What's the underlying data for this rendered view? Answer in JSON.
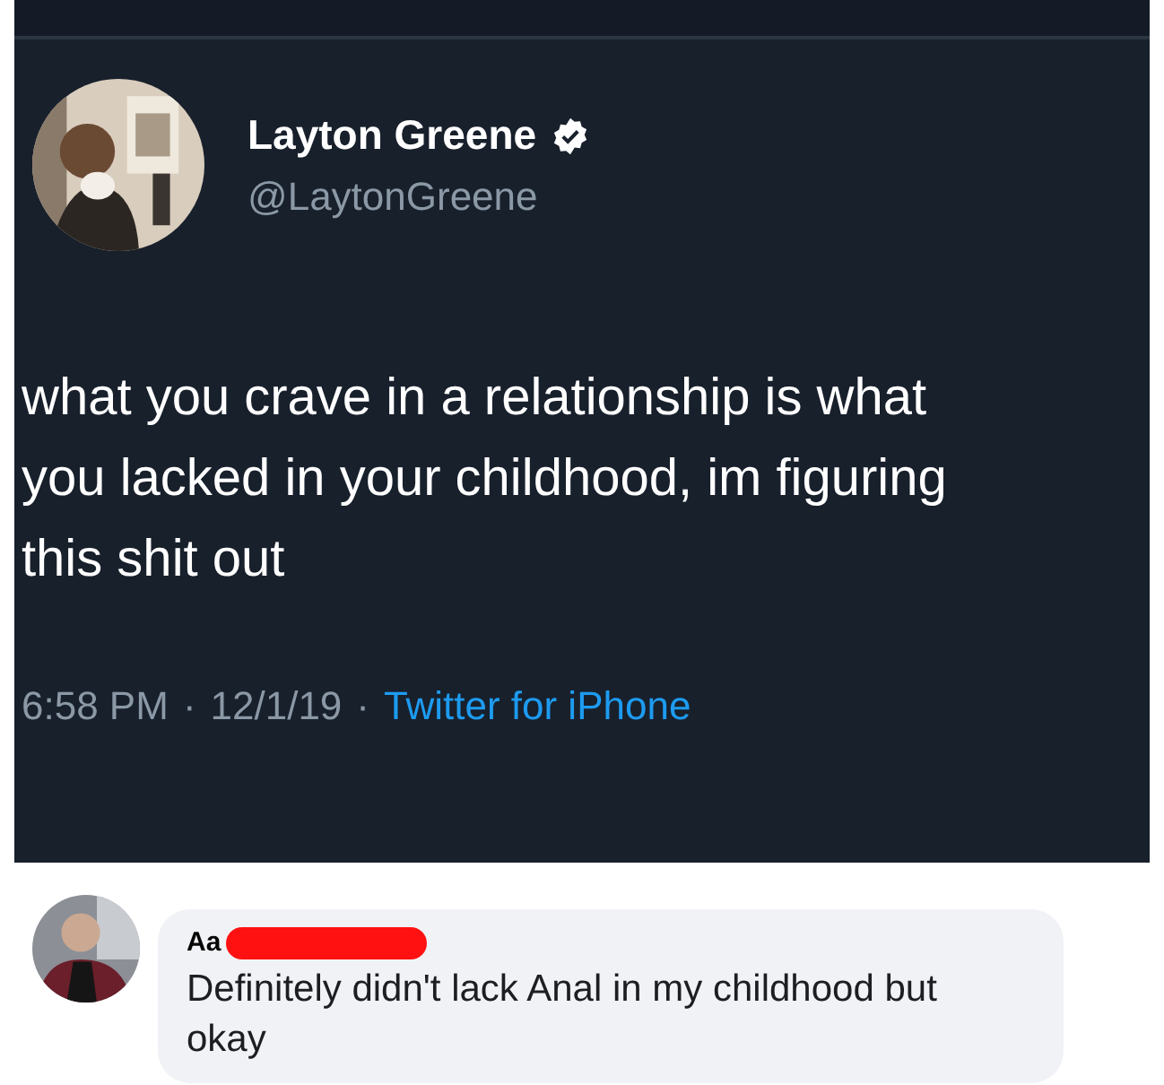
{
  "tweet": {
    "author": {
      "name": "Layton Greene",
      "handle": "@LaytonGreene",
      "verified": true
    },
    "text": "what you crave in a relationship is what you lacked in your childhood, im figuring this shit out",
    "time": "6:58 PM",
    "separator_1": "·",
    "date": "12/1/19",
    "separator_2": "·",
    "source": "Twitter for iPhone"
  },
  "comment": {
    "author": {
      "name": "Aa",
      "redacted": true
    },
    "text": "Definitely didn't lack Anal in my childhood but okay"
  }
}
